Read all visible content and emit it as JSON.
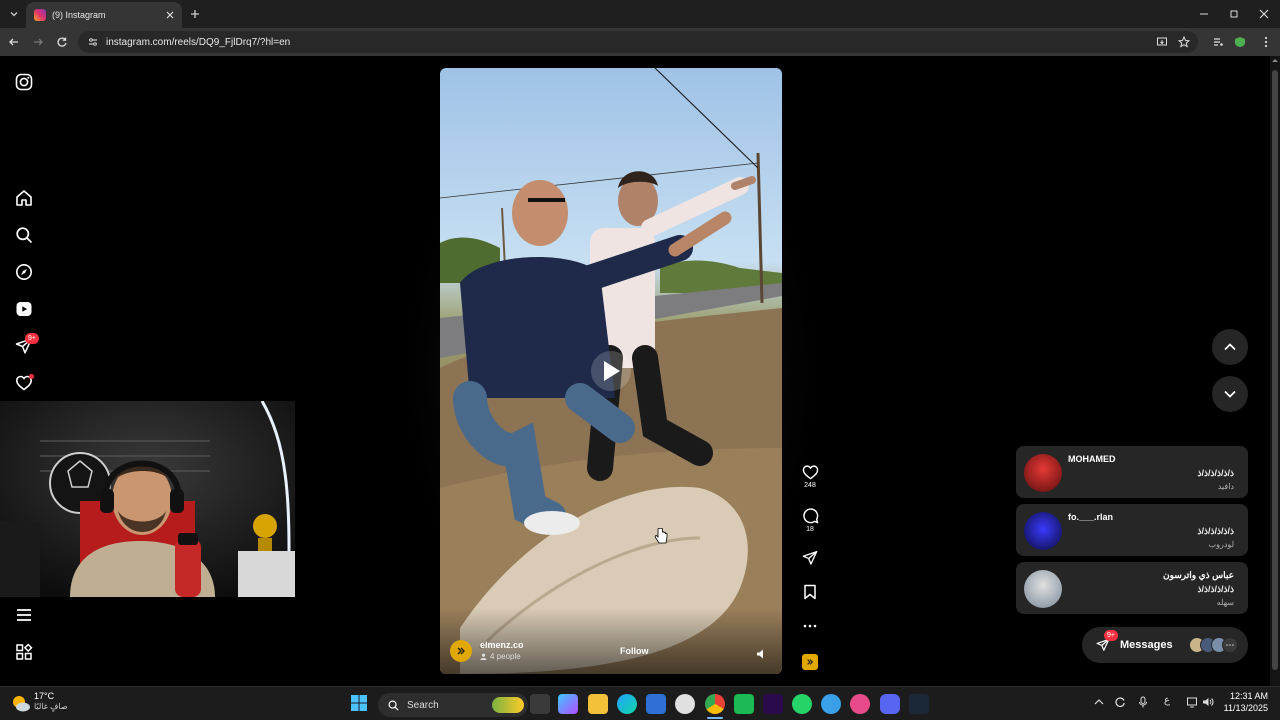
{
  "browser": {
    "tab_title": "(9) Instagram",
    "url": "instagram.com/reels/DQ9_FjlDrq7/?hl=en"
  },
  "instagram": {
    "nav_badge": "9+",
    "reel": {
      "username": "elmenz.co",
      "subline": "4 people",
      "follow_label": "Follow",
      "likes": "248",
      "comments": "18"
    },
    "messages": [
      {
        "name": "MOHAMED",
        "preview": "ذ/ذ/ذ/ذ/ذ/ذ",
        "sub": "دافيد"
      },
      {
        "name": "fo.___.rlan",
        "preview": "ذ/ذ/ذ/ذ/ذ/ذ",
        "sub": "لودروب"
      },
      {
        "name": "عباس ذي واترسون",
        "preview": "ذ/ذ/ذ/ذ/ذ/ذ",
        "sub": "سهله"
      }
    ],
    "messages_label": "Messages",
    "messages_badge": "9+"
  },
  "taskbar": {
    "weather_temp": "17°C",
    "weather_desc": "صافٍ غالبًا",
    "search_placeholder": "Search",
    "time": "12:31 AM",
    "date": "11/13/2025",
    "lang": "ع"
  },
  "colors": {
    "ig_badge": "#ff3040",
    "chrome_dark": "#1f1f1f",
    "card_bg": "#262626"
  }
}
